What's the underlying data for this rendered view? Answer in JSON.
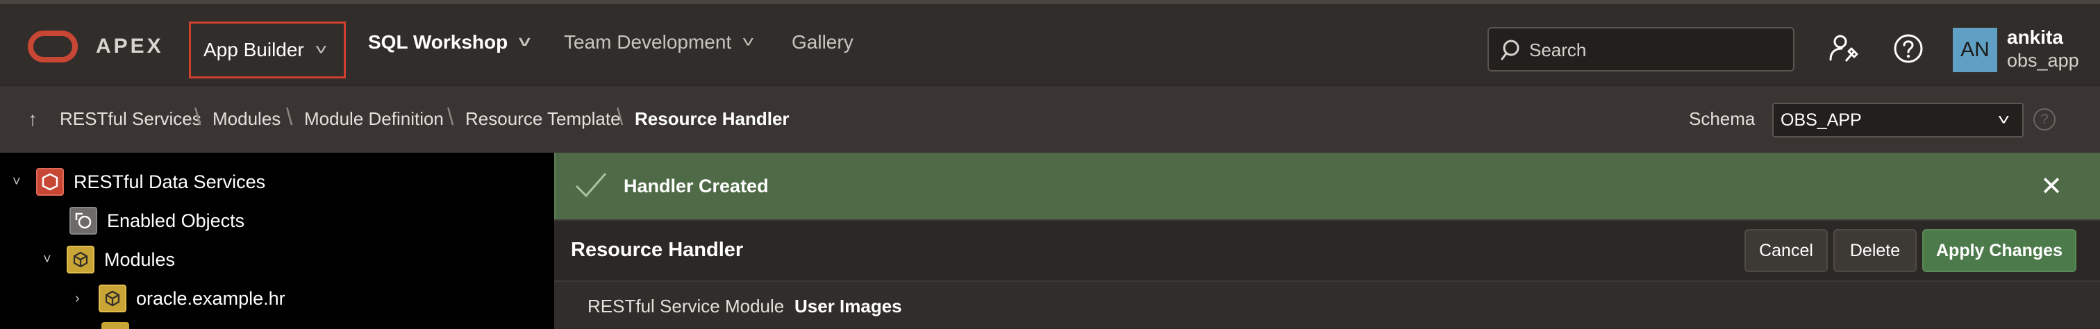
{
  "header": {
    "logo_text": "APEX",
    "nav": [
      {
        "label": "App Builder"
      },
      {
        "label": "SQL Workshop"
      },
      {
        "label": "Team Development"
      },
      {
        "label": "Gallery"
      }
    ],
    "search": {
      "placeholder": "Search"
    },
    "user": {
      "initials": "AN",
      "name": "ankita",
      "workspace": "obs_app"
    },
    "icons": [
      "admin-wrench-icon",
      "help-icon"
    ]
  },
  "breadcrumb": {
    "items": [
      "RESTful Services",
      "Modules",
      "Module Definition",
      "Resource Template",
      "Resource Handler"
    ],
    "schema_label": "Schema",
    "schema_value": "OBS_APP"
  },
  "tree": {
    "root": "RESTful Data Services",
    "enabled_objects": "Enabled Objects",
    "modules": "Modules",
    "module_item": "oracle.example.hr"
  },
  "notification": {
    "message": "Handler Created"
  },
  "region": {
    "title": "Resource Handler",
    "buttons": {
      "cancel": "Cancel",
      "delete": "Delete",
      "apply": "Apply Changes"
    },
    "field_label": "RESTful Service Module",
    "field_value": "User Images"
  },
  "colors": {
    "accent_red": "#c74634",
    "success_bg": "#4f6a46",
    "apply_green": "#4d7a4a"
  }
}
